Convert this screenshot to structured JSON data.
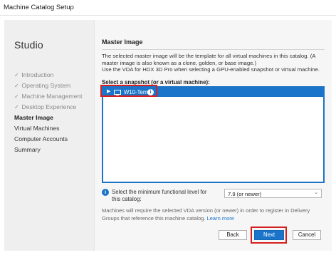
{
  "window": {
    "title": "Machine Catalog Setup"
  },
  "sidebar": {
    "brand": "Studio",
    "steps": [
      {
        "label": "Introduction",
        "done": true
      },
      {
        "label": "Operating System",
        "done": true
      },
      {
        "label": "Machine Management",
        "done": true
      },
      {
        "label": "Desktop Experience",
        "done": true
      },
      {
        "label": "Master Image",
        "current": true
      },
      {
        "label": "Virtual Machines"
      },
      {
        "label": "Computer Accounts"
      },
      {
        "label": "Summary"
      }
    ]
  },
  "main": {
    "heading": "Master Image",
    "description_line1": "The selected master image will be the template for all virtual machines in this catalog. (A master image is also known as a clone, golden, or base image.)",
    "description_line2": "Use the VDA for HDX 3D Pro when selecting a GPU-enabled snapshot or virtual machine.",
    "snapshot_label": "Select a snapshot (or a virtual machine):",
    "tree": {
      "selected_item": "W10-Tem"
    },
    "functional_level_label": "Select the minimum functional level for this catalog:",
    "functional_level_value": "7.9 (or newer)",
    "note": "Machines will require the selected VDA version (or newer) in order to register in Delivery Groups that reference this machine catalog.",
    "learn_more": "Learn more"
  },
  "footer": {
    "back": "Back",
    "next": "Next",
    "cancel": "Cancel"
  },
  "icons": {
    "check": "checkmark-icon",
    "expand": "expand-arrow-icon",
    "vm": "virtual-machine-icon",
    "info": "info-icon",
    "dropdown": "chevron-down-icon"
  },
  "colors": {
    "accent": "#1a74c9",
    "highlight": "#d42020"
  }
}
